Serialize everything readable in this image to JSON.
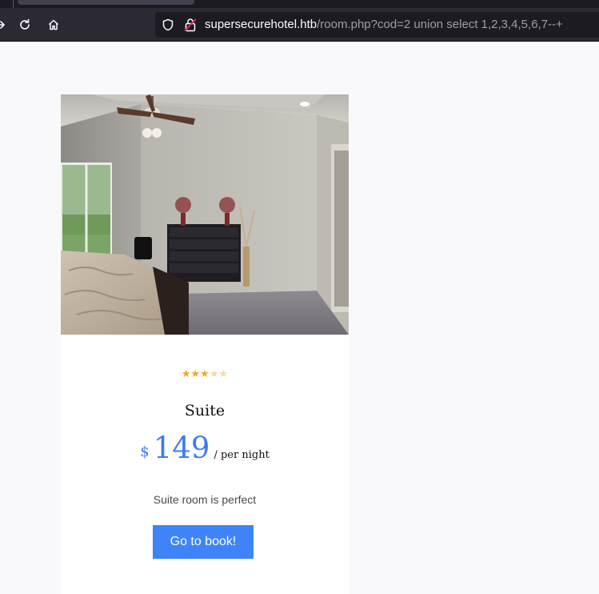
{
  "browser": {
    "url_host": "supersecurehotel.htb",
    "url_path": "/room.php?cod=2 union select 1,2,3,4,5,6,7--+",
    "icons": [
      "forward-icon",
      "reload-icon",
      "home-icon",
      "shield-icon",
      "insecure-lock-icon"
    ]
  },
  "room": {
    "stars_filled": "★★★",
    "stars_empty": "★★",
    "rating": 3,
    "rating_max": 5,
    "name": "Suite",
    "currency": "$",
    "price": "149",
    "unit": "/ per night",
    "description": "Suite room is perfect",
    "book_label": "Go to book!"
  },
  "colors": {
    "accent": "#3f83f8",
    "price": "#3c7bf0",
    "star": "#f5a623"
  }
}
